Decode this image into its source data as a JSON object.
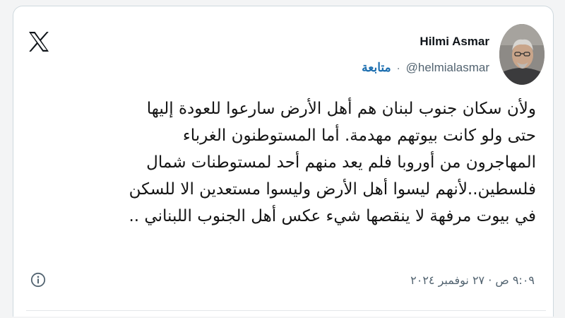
{
  "tweet": {
    "author": {
      "display_name": "Hilmi Asmar",
      "handle": "@helmialasmar",
      "separator": "·",
      "follow_label": "متابعة"
    },
    "body_lines": [
      "ولأن سكان جنوب لبنان هم أهل الأرض سارعوا للعودة إليها",
      "حتى ولو كانت بيوتهم مهدمة. أما المستوطنون الغرباء",
      "المهاجرون من أوروبا فلم يعد منهم أحد لمستوطنات شمال",
      "فلسطين..لأنهم ليسوا أهل الأرض وليسوا مستعدين الا للسكن",
      "في بيوت مرفهة لا ينقصها شيء عكس أهل الجنوب اللبناني .."
    ],
    "timestamp": "٩:٠٩ ص · ٢٧ نوفمبر ٢٠٢٤",
    "icons": {
      "platform_logo": "x-logo-icon",
      "info": "info-icon"
    }
  },
  "colors": {
    "link": "#1d6fb0",
    "secondary_text": "#536471",
    "primary_text": "#0f1419",
    "card_border": "#cfd9de"
  }
}
